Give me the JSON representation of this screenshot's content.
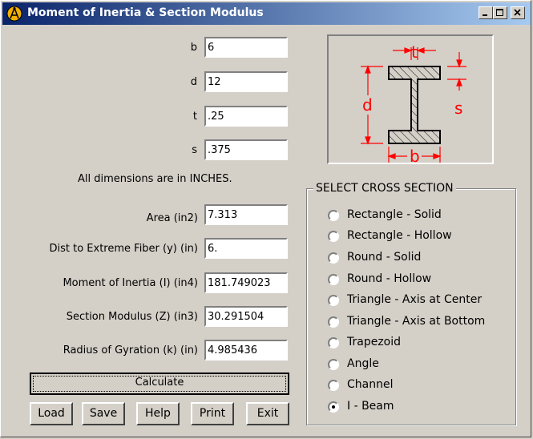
{
  "window": {
    "title": "Moment of Inertia & Section Modulus"
  },
  "inputs": [
    {
      "label": "b",
      "value": "6"
    },
    {
      "label": "d",
      "value": "12"
    },
    {
      "label": "t",
      "value": ".25"
    },
    {
      "label": "s",
      "value": ".375"
    }
  ],
  "note": "All dimensions are in INCHES.",
  "outputs": [
    {
      "label": "Area  (in2)",
      "value": "7.313"
    },
    {
      "label": "Dist to Extreme Fiber (y)   (in)",
      "value": "6."
    },
    {
      "label": "Moment of Inertia (I)  (in4)",
      "value": "181.749023"
    },
    {
      "label": "Section Modulus (Z)  (in3)",
      "value": "30.291504"
    },
    {
      "label": "Radius of Gyration (k)   (in)",
      "value": "4.985436"
    }
  ],
  "buttons": {
    "calculate": "Calculate",
    "load": "Load",
    "save": "Save",
    "help": "Help",
    "print": "Print",
    "exit": "Exit"
  },
  "diagram": {
    "labels": {
      "t": "t",
      "s": "s",
      "d": "d",
      "b": "b"
    },
    "dimension_color": "#ff0000"
  },
  "cross_section": {
    "title": "SELECT CROSS SECTION",
    "options": [
      "Rectangle - Solid",
      "Rectangle - Hollow",
      "Round - Solid",
      "Round - Hollow",
      "Triangle - Axis at Center",
      "Triangle - Axis at Bottom",
      "Trapezoid",
      "Angle",
      "Channel",
      "I - Beam"
    ],
    "selected": "I - Beam"
  },
  "colors": {
    "titlebar_start": "#0a246a",
    "titlebar_end": "#a6caf0",
    "face": "#d4d0c8"
  }
}
